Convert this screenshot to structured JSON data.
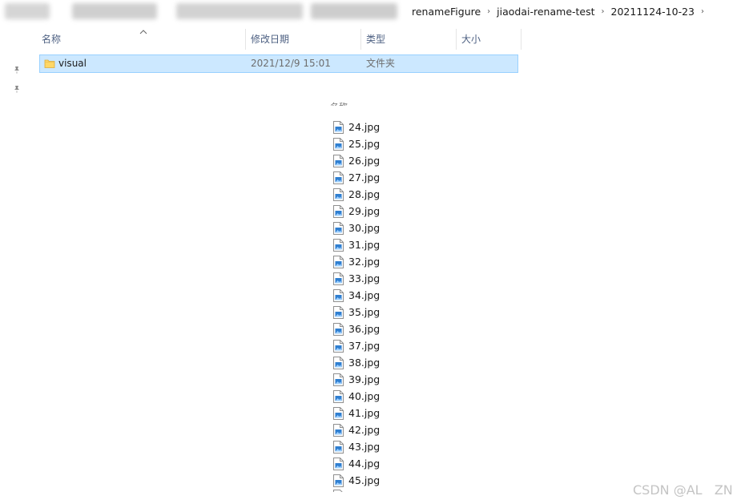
{
  "breadcrumb": {
    "items": [
      "renameFigure",
      "jiaodai-rename-test",
      "20211124-10-23"
    ],
    "separator": "›"
  },
  "columns": {
    "name": "名称",
    "modified": "修改日期",
    "type": "类型",
    "size": "大小"
  },
  "folder_row": {
    "name": "visual",
    "modified": "2021/12/9 15:01",
    "type": "文件夹",
    "size": ""
  },
  "files": [
    "24.jpg",
    "25.jpg",
    "26.jpg",
    "27.jpg",
    "28.jpg",
    "29.jpg",
    "30.jpg",
    "31.jpg",
    "32.jpg",
    "33.jpg",
    "34.jpg",
    "35.jpg",
    "36.jpg",
    "37.jpg",
    "38.jpg",
    "39.jpg",
    "40.jpg",
    "41.jpg",
    "42.jpg",
    "43.jpg",
    "44.jpg",
    "45.jpg"
  ],
  "second_pane_header": "名称",
  "watermark": "CSDN @AL   ZN",
  "colors": {
    "selection_bg": "#cce8ff",
    "selection_border": "#99d1ff",
    "header_text": "#4d6082",
    "folder_yellow": "#ffd766",
    "jpg_blue": "#2f7fd1"
  },
  "icons": {
    "folder": "folder-icon",
    "jpg": "jpg-file-icon",
    "pin": "pin-icon",
    "sort": "sort-ascending-icon",
    "separator": "chevron-right-icon"
  }
}
